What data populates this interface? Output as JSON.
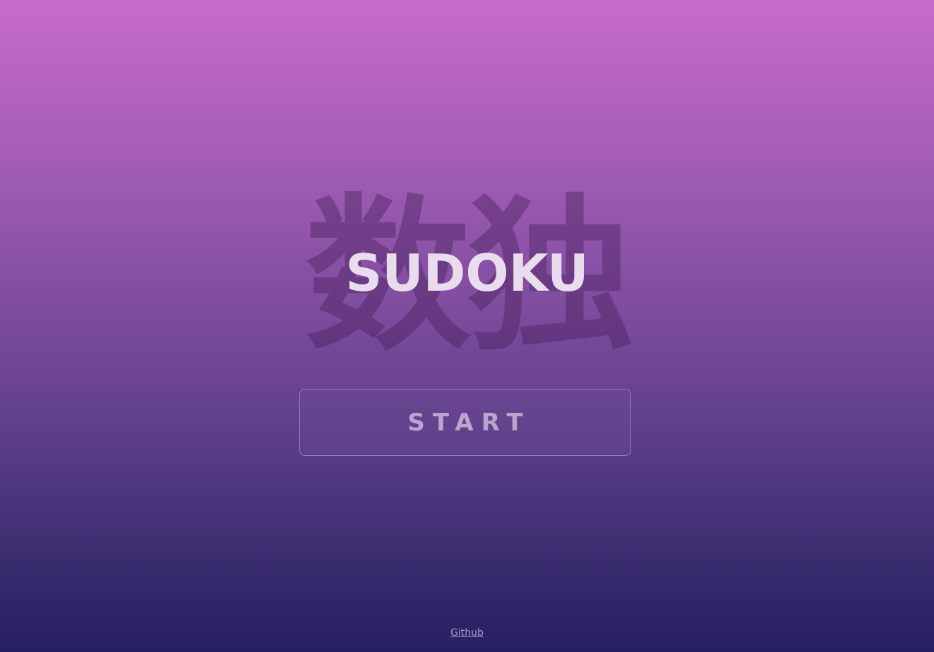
{
  "background_kanji": "数独",
  "title": "SUDOKU",
  "start_button": {
    "label": "START"
  },
  "footer": {
    "github_link": "Github"
  },
  "colors": {
    "gradient_top": "#c86bcc",
    "gradient_bottom": "#251f62",
    "title_text": "#e9dcec",
    "button_text": "#b9a6cc",
    "link_text": "#a799c8"
  }
}
